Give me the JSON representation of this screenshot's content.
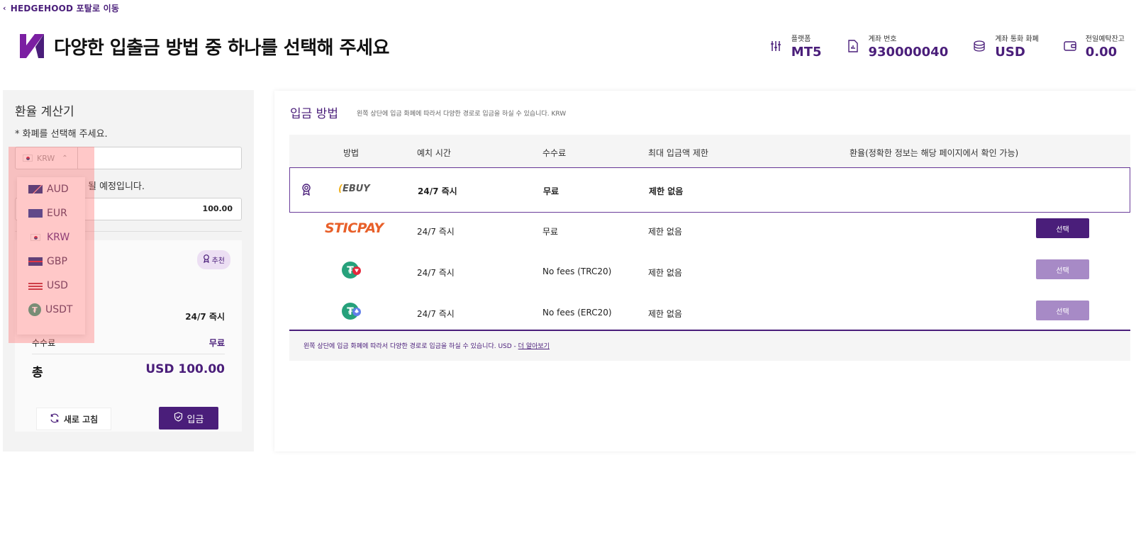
{
  "nav": {
    "back_label": "HEDGEHOOD 포탈로 이동"
  },
  "header": {
    "title": "다양한 입출금 방법 중 하나를 선택해 주세요"
  },
  "account": {
    "platform_label": "플랫폼",
    "platform_value": "MT5",
    "account_label": "계좌 번호",
    "account_value": "930000040",
    "currency_label": "계좌 통화 화폐",
    "currency_value": "USD",
    "balance_label": "전일예탁잔고",
    "balance_value": "0.00"
  },
  "calculator": {
    "title": "환율 계산기",
    "select_prompt": "* 화폐를 선택해 주세요.",
    "selected_currency": "KRW",
    "note": "될 예정입니다.",
    "amount": "100.00",
    "badge": "추천",
    "time_value": "24/7 즉시",
    "fee_label": "수수료",
    "fee_value": "무료",
    "total_label": "총",
    "total_value": "USD 100.00",
    "refresh_label": "새로 고침",
    "deposit_label": "입금",
    "options": [
      "AUD",
      "EUR",
      "KRW",
      "GBP",
      "USD",
      "USDT"
    ]
  },
  "methods": {
    "title": "입금 방법",
    "subtitle": "왼쪽 상단에 입금 화폐에 따라서 다양한 경로로 입금을 하실 수 있습니다. KRW",
    "headers": {
      "method": "방법",
      "time": "예치 시간",
      "fee": "수수료",
      "limit": "최대 입금액 제한",
      "rate": "환율(정확한 정보는 해당 페이지에서 확인 가능)"
    },
    "rows": [
      {
        "logo": "EBUY",
        "time": "24/7 즉시",
        "fee": "무료",
        "limit": "제한 없음"
      },
      {
        "logo": "STICPAY",
        "time": "24/7 즉시",
        "fee": "무료",
        "limit": "제한 없음",
        "button": "선택"
      },
      {
        "logo": "tether-trc20-icon",
        "time": "24/7 즉시",
        "fee": "No fees (TRC20)",
        "limit": "제한 없음",
        "button": "선택"
      },
      {
        "logo": "tether-erc20-icon",
        "time": "24/7 즉시",
        "fee": "No fees (ERC20)",
        "limit": "제한 없음",
        "button": "선택"
      }
    ],
    "footer_text": "왼쪽 상단에 입금 화폐에 따라서 다양한 경로로 입금을 하실 수 있습니다. USD -",
    "footer_link": "더 알아보기"
  },
  "colors": {
    "brand": "#4a1e7a",
    "brand_light": "#a78ac6",
    "sticpay": "#e8602a",
    "tether": "#26a17b"
  }
}
